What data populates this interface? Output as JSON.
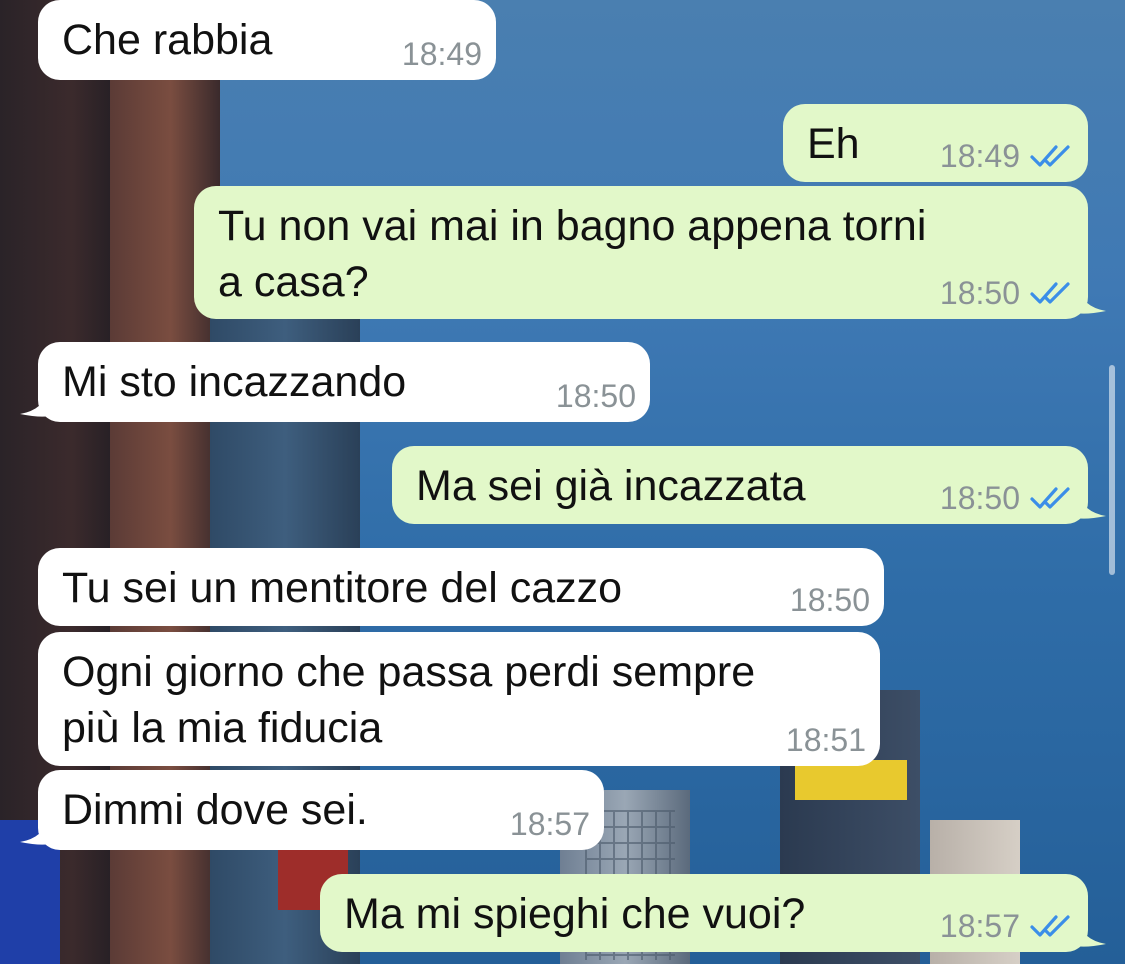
{
  "messages": [
    {
      "side": "in",
      "text": "Che rabbia",
      "time": "18:49"
    },
    {
      "side": "out",
      "text": "Eh",
      "time": "18:49"
    },
    {
      "side": "out",
      "text": "Tu non vai mai in bagno appena torni\na casa?",
      "time": "18:50"
    },
    {
      "side": "in",
      "text": "Mi sto incazzando",
      "time": "18:50"
    },
    {
      "side": "out",
      "text": "Ma sei già incazzata",
      "time": "18:50"
    },
    {
      "side": "in",
      "text": "Tu sei un mentitore del cazzo",
      "time": "18:50"
    },
    {
      "side": "in",
      "text": "Ogni giorno che passa perdi sempre\npiù la mia fiducia",
      "time": "18:51"
    },
    {
      "side": "in",
      "text": "Dimmi dove sei.",
      "time": "18:57"
    },
    {
      "side": "out",
      "text": "Ma mi spieghi che vuoi?",
      "time": "18:57"
    }
  ],
  "colors": {
    "incoming_bubble": "#ffffff",
    "outgoing_bubble": "#e2f8c9",
    "read_ticks": "#3b8ee8",
    "timestamp": "#8a9296"
  },
  "icons": {
    "read_receipt": "double-check-icon"
  }
}
